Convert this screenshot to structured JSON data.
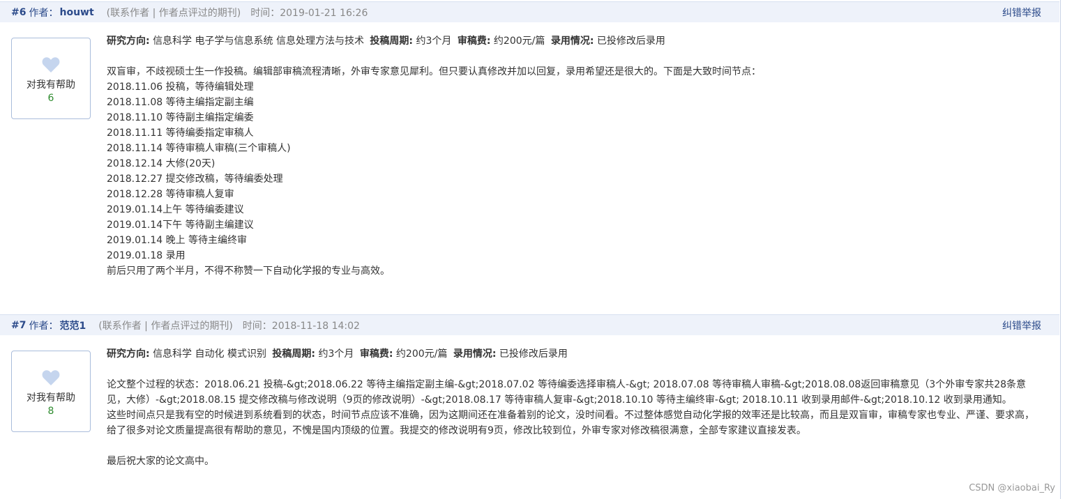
{
  "posts": [
    {
      "number": "#6",
      "author_label": "作者：",
      "author": "houwt",
      "contact": "(联系作者 | 作者点评过的期刊)",
      "time_label": "时间：",
      "time": "2019-01-21 16:26",
      "report": "纠错举报",
      "helpful_label": "对我有帮助",
      "helpful_count": "6",
      "meta": {
        "direction_label": "研究方向:",
        "direction": "信息科学 电子学与信息系统 信息处理方法与技术",
        "cycle_label": "投稿周期:",
        "cycle": "约3个月",
        "fee_label": "审稿费:",
        "fee": "约200元/篇",
        "result_label": "录用情况:",
        "result": "已投修改后录用"
      },
      "lines": [
        "双盲审，不歧视硕士生一作投稿。编辑部审稿流程清晰，外审专家意见犀利。但只要认真修改并加以回复，录用希望还是很大的。下面是大致时间节点：",
        "2018.11.06 投稿，等待编辑处理",
        "2018.11.08 等待主编指定副主编",
        "2018.11.10 等待副主编指定编委",
        "2018.11.11 等待编委指定审稿人",
        "2018.11.14 等待审稿人审稿(三个审稿人)",
        "2018.12.14 大修(20天)",
        "2018.12.27 提交修改稿，等待编委处理",
        "2018.12.28 等待审稿人复审",
        "2019.01.14上午 等待编委建议",
        "2019.01.14下午 等待副主编建议",
        "2019.01.14 晚上 等待主编终审",
        "2019.01.18 录用",
        "前后只用了两个半月，不得不称赞一下自动化学报的专业与高效。"
      ]
    },
    {
      "number": "#7",
      "author_label": "作者：",
      "author": "范范1",
      "contact": "(联系作者 | 作者点评过的期刊)",
      "time_label": "时间：",
      "time": "2018-11-18 14:02",
      "report": "纠错举报",
      "helpful_label": "对我有帮助",
      "helpful_count": "8",
      "meta": {
        "direction_label": "研究方向:",
        "direction": "信息科学 自动化 模式识别",
        "cycle_label": "投稿周期:",
        "cycle": "约3个月",
        "fee_label": "审稿费:",
        "fee": "约200元/篇",
        "result_label": "录用情况:",
        "result": "已投修改后录用"
      },
      "paragraphs": [
        "论文整个过程的状态：2018.06.21 投稿-&gt;2018.06.22 等待主编指定副主编-&gt;2018.07.02 等待编委选择审稿人-&gt; 2018.07.08 等待审稿人审稿-&gt;2018.08.08返回审稿意见（3个外审专家共28条意见，大修）-&gt;2018.08.15 提交修改稿与修改说明（9页的修改说明）-&gt;2018.08.17 等待审稿人复审-&gt;2018.10.10 等待主编终审-&gt; 2018.10.11 收到录用邮件-&gt;2018.10.12 收到录用通知。",
        "这些时间点只是我有空的时候进到系统看到的状态，时间节点应该不准确，因为这期间还在准备着别的论文，没时间看。不过整体感觉自动化学报的效率还是比较高，而且是双盲审，审稿专家也专业、严谨、要求高，给了很多对论文质量提高很有帮助的意见，不愧是国内顶级的位置。我提交的修改说明有9页，修改比较到位，外审专家对修改稿很满意，全部专家建议直接发表。",
        "最后祝大家的论文高中。"
      ]
    }
  ],
  "watermark": "CSDN @xiaobai_Ry",
  "colors": {
    "header_bg": "#eef2fa",
    "link": "#2b4a8a",
    "count": "#2e8b2e",
    "heart": "#c5d5ee"
  }
}
